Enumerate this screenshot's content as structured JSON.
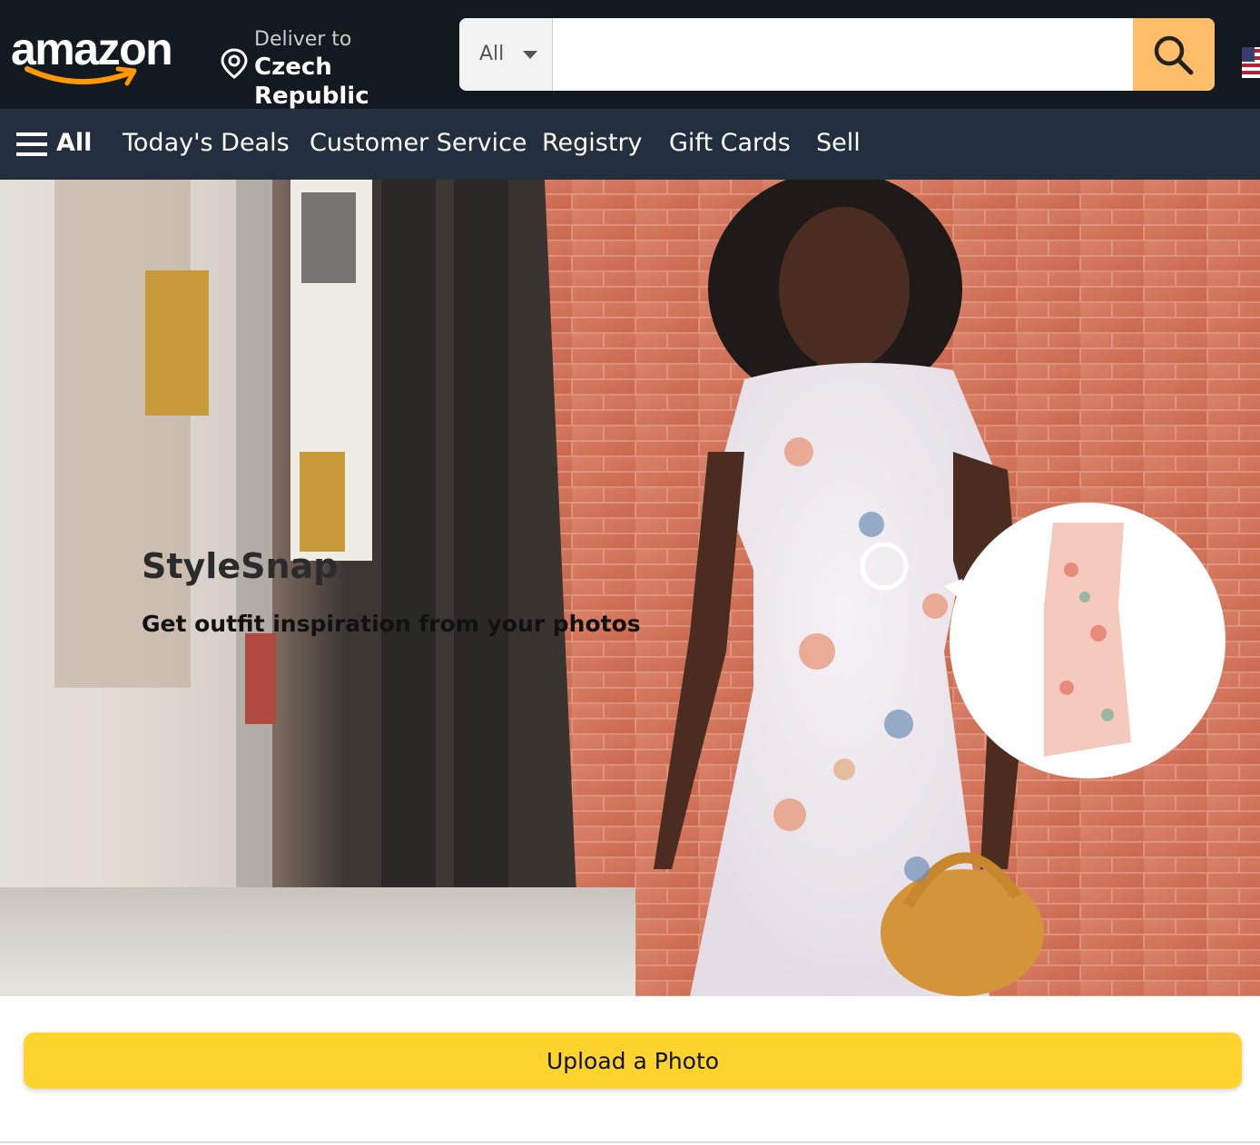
{
  "header": {
    "logo_text": "amazon",
    "deliver_label": "Deliver to",
    "deliver_location": "Czech Republic",
    "search": {
      "category": "All",
      "value": "",
      "placeholder": ""
    }
  },
  "nav": {
    "all_label": "All",
    "items": [
      "Today's Deals",
      "Customer Service",
      "Registry",
      "Gift Cards",
      "Sell"
    ]
  },
  "hero": {
    "title": "StyleSnap",
    "subtitle": "Get outfit inspiration from your photos"
  },
  "upload": {
    "button_label": "Upload a Photo"
  },
  "colors": {
    "header_bg": "#131921",
    "nav_bg": "#232f3e",
    "search_button": "#febd69",
    "upload_button": "#ffd42e",
    "logo_smile": "#ff9900"
  }
}
